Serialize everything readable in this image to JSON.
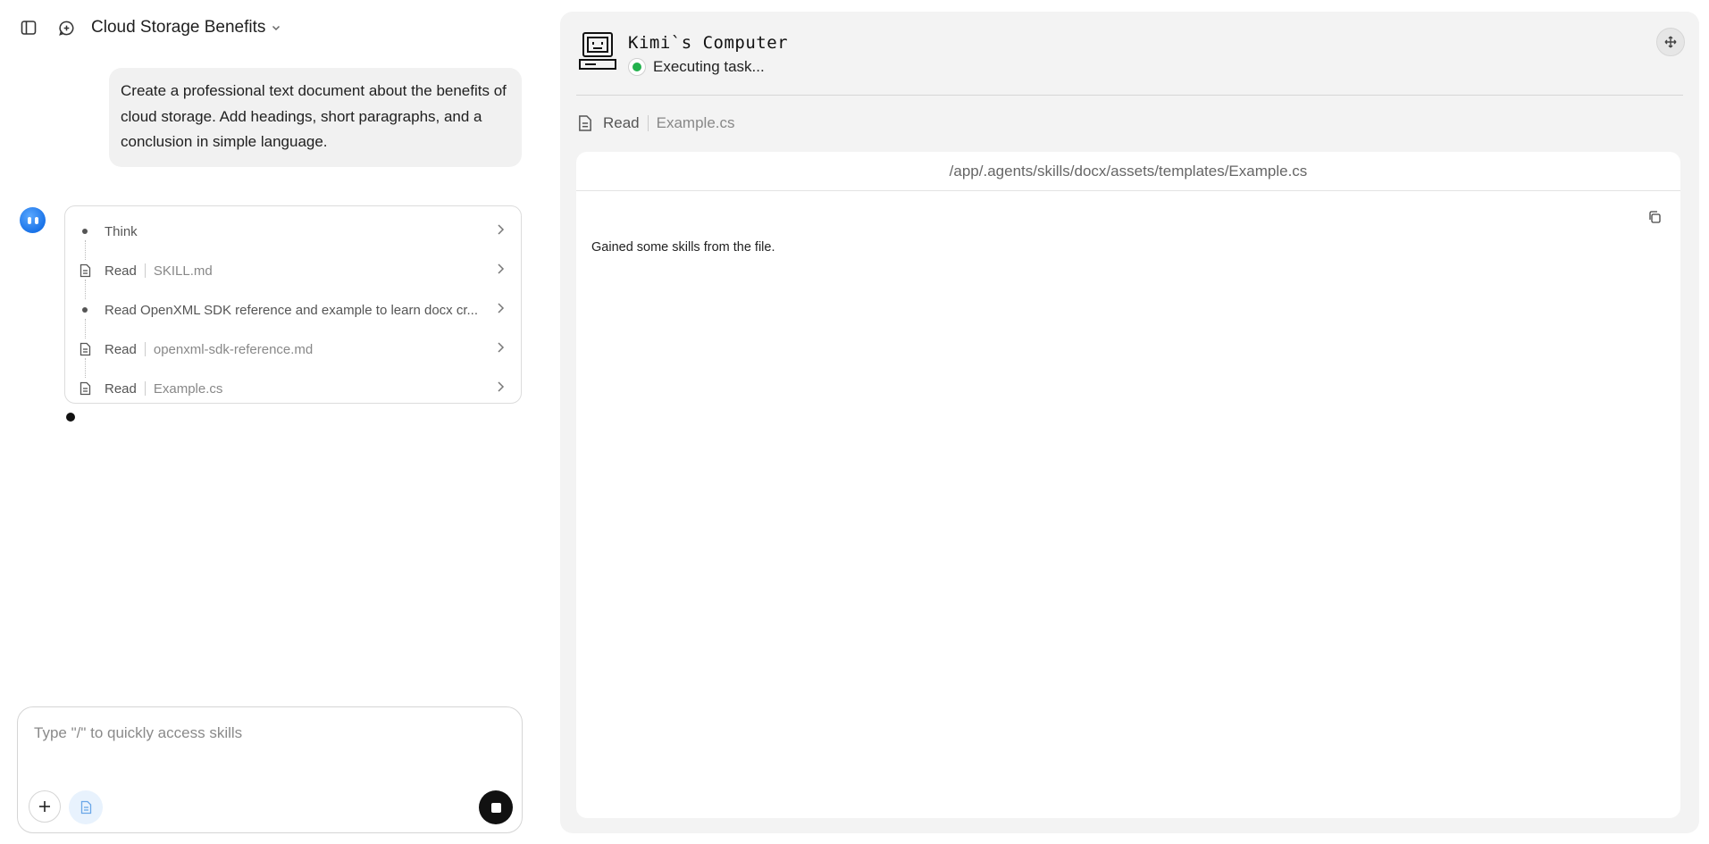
{
  "header": {
    "title": "Cloud Storage Benefits"
  },
  "user_message": "Create a professional text document about the benefits of cloud storage. Add headings, short paragraphs, and a conclusion in simple language.",
  "steps": [
    {
      "kind": "dot",
      "label": "Think",
      "file": ""
    },
    {
      "kind": "doc",
      "label": "Read",
      "file": "SKILL.md"
    },
    {
      "kind": "dot",
      "label": "Read OpenXML SDK reference and example to learn docx cr...",
      "file": ""
    },
    {
      "kind": "doc",
      "label": "Read",
      "file": "openxml-sdk-reference.md"
    },
    {
      "kind": "doc",
      "label": "Read",
      "file": "Example.cs"
    }
  ],
  "composer": {
    "placeholder": "Type \"/\" to quickly access skills"
  },
  "computer": {
    "title": "Kimi`s Computer",
    "status": "Executing task...",
    "status_color": "#22b14c",
    "action_label": "Read",
    "action_file": "Example.cs",
    "file_path": "/app/.agents/skills/docx/assets/templates/Example.cs",
    "file_content": "Gained some skills from the file."
  }
}
